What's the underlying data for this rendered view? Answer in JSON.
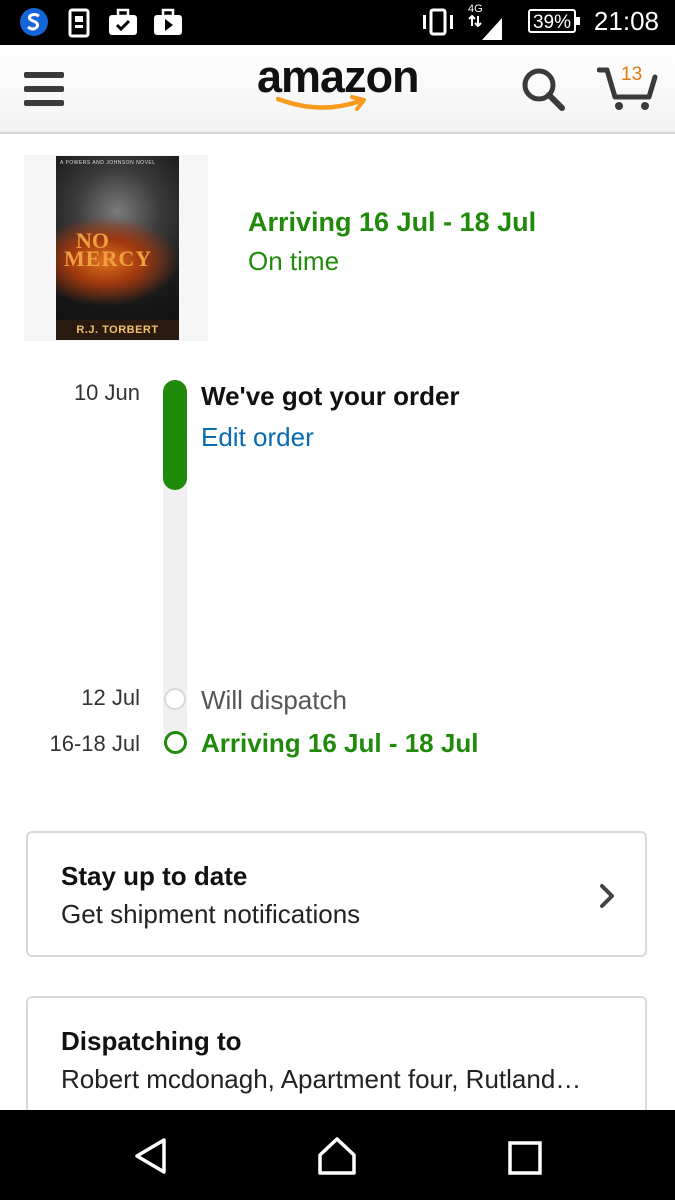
{
  "status_bar": {
    "time": "21:08",
    "battery": "39%",
    "network": "4G",
    "icons": [
      "app-s-icon",
      "clipboard-icon",
      "briefcase-check-icon",
      "briefcase-play-icon",
      "vibrate-icon",
      "signal-icon",
      "battery-icon"
    ]
  },
  "header": {
    "logo": "amazon",
    "cart_count": "13",
    "icons": [
      "menu-icon",
      "search-icon",
      "cart-icon"
    ]
  },
  "product": {
    "cover": {
      "series": "A POWERS AND JOHNSON NOVEL",
      "title_line1": "NO",
      "title_line2": "MERCY",
      "author": "R.J. TORBERT"
    },
    "arriving": "Arriving 16 Jul - 18 Jul",
    "status": "On time"
  },
  "timeline": {
    "progress_fraction": 0.3,
    "events": [
      {
        "date": "10 Jun",
        "title": "We've got your order",
        "link": "Edit order"
      },
      {
        "date": "12 Jul",
        "title": "Will dispatch"
      },
      {
        "date": "16-18 Jul",
        "title": "Arriving 16 Jul - 18 Jul"
      }
    ]
  },
  "cards": {
    "notify": {
      "title": "Stay up to date",
      "subtitle": "Get shipment notifications"
    },
    "dispatch": {
      "title": "Dispatching to",
      "subtitle": "Robert mcdonagh, Apartment four, Rutland…"
    }
  },
  "colors": {
    "green": "#208a0a",
    "link": "#0a6bb3",
    "cart_count": "#e47911"
  }
}
